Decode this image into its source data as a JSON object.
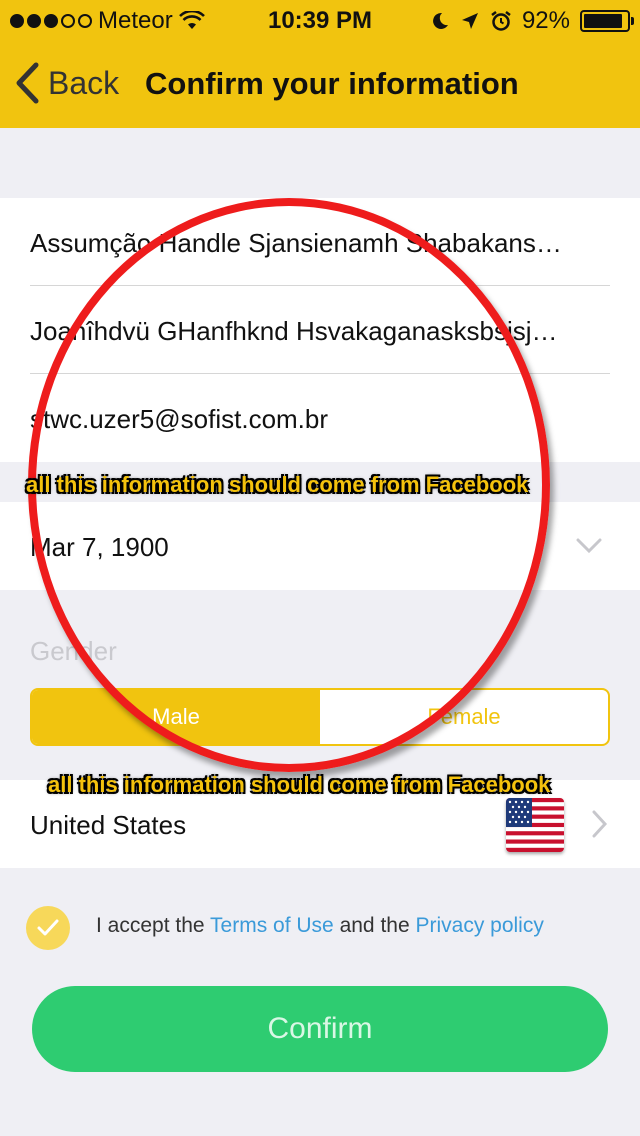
{
  "status_bar": {
    "carrier": "Meteor",
    "time": "10:39 PM",
    "battery": "92%",
    "signal_icon": "signal-dots-icon",
    "wifi_icon": "wifi-icon"
  },
  "nav": {
    "back_label": "Back",
    "title": "Confirm your information"
  },
  "form": {
    "name_value": "Assumção Handle Sjansienamh Shabakans…",
    "surname_value": "Joanîhdvü GHanfhknd Hsvakaganasksbsjsj…",
    "email_value": "stwc.uzer5@sofist.com.br",
    "birthdate_value": "Mar 7, 1900",
    "gender_label": "Gender",
    "gender_options": [
      "Male",
      "Female"
    ],
    "gender_selected": "Male",
    "country_value": "United States"
  },
  "terms": {
    "prefix": "I accept the ",
    "terms_link": "Terms of Use",
    "middle": " and the ",
    "privacy_link": "Privacy policy"
  },
  "confirm_label": "Confirm",
  "annotations": {
    "top": "all this information should come from Facebook",
    "bottom": "all this information should come from Facebook"
  },
  "colors": {
    "accent_yellow": "#f1c40f",
    "confirm_green": "#2ecc71",
    "link_blue": "#3a9ad9",
    "annotation_red": "#ee1c1c"
  }
}
